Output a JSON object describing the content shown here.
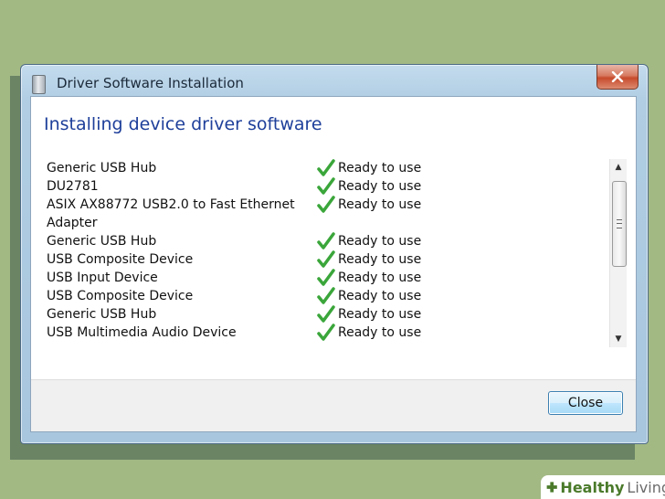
{
  "window": {
    "title": "Driver Software Installation",
    "title_icon": "usb-drive-icon"
  },
  "dialog": {
    "heading": "Installing device driver software",
    "close_button": "Close",
    "devices": [
      {
        "name": "Generic USB Hub",
        "status": "Ready to use"
      },
      {
        "name": "DU2781",
        "status": "Ready to use"
      },
      {
        "name": "ASIX AX88772 USB2.0 to Fast Ethernet Adapter",
        "status": "Ready to use"
      },
      {
        "name": "Generic USB Hub",
        "status": "Ready to use"
      },
      {
        "name": "USB Composite Device",
        "status": "Ready to use"
      },
      {
        "name": "USB Input Device",
        "status": "Ready to use"
      },
      {
        "name": "USB Composite Device",
        "status": "Ready to use"
      },
      {
        "name": "Generic USB Hub",
        "status": "Ready to use"
      },
      {
        "name": "USB Multimedia Audio Device",
        "status": "Ready to use"
      }
    ]
  },
  "watermark": {
    "part1": "Healthy",
    "part2": "Living"
  },
  "colors": {
    "background": "#a2b984",
    "heading": "#1e3f9a",
    "check": "#3aa63a",
    "close_x": "#c74a2b"
  }
}
